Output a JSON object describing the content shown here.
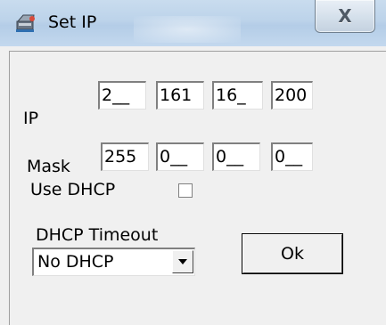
{
  "window": {
    "title": "Set IP",
    "close_label": "X",
    "icon": "network-settings-icon"
  },
  "ip": {
    "label": "IP",
    "octets": [
      "2__",
      "161",
      "16_",
      "200"
    ]
  },
  "mask": {
    "label": "Mask",
    "octets": [
      "255",
      "0__",
      "0__",
      "0__"
    ]
  },
  "dhcp": {
    "label": "Use DHCP",
    "checked": false
  },
  "dhcp_timeout": {
    "label": "DHCP Timeout",
    "selected": "No DHCP"
  },
  "ok_button": {
    "label": "Ok"
  }
}
